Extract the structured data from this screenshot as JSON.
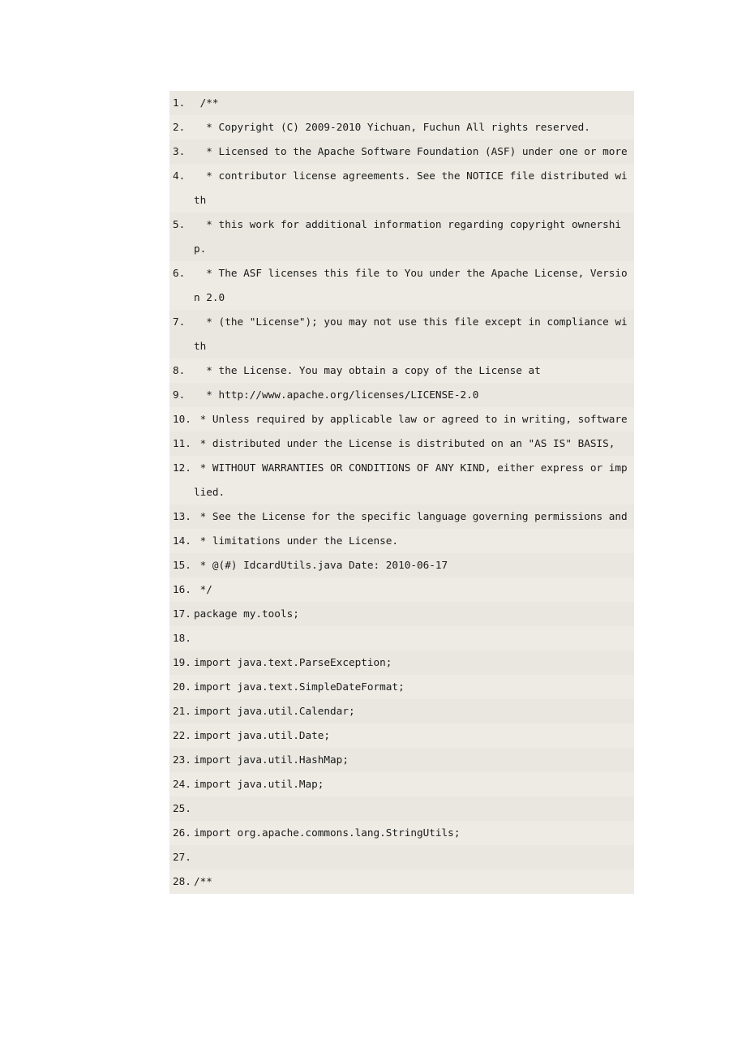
{
  "document": {
    "language": "java",
    "background_color": "#e9e7e0",
    "page_background": "#ffffff",
    "text_color": "#1a1a1a",
    "first_line_number": 1,
    "last_line_number": 28
  },
  "code": {
    "lines": [
      {
        "number": "1.",
        "text": " /**"
      },
      {
        "number": "2.",
        "text": "  * Copyright (C) 2009-2010 Yichuan, Fuchun All rights reserved."
      },
      {
        "number": "3.",
        "text": "  * Licensed to the Apache Software Foundation (ASF) under one or more"
      },
      {
        "number": "4.",
        "text": "  * contributor license agreements. See the NOTICE file distributed with"
      },
      {
        "number": "5.",
        "text": "  * this work for additional information regarding copyright ownership. "
      },
      {
        "number": "6.",
        "text": "  * The ASF licenses this file to You under the Apache License, Version 2.0"
      },
      {
        "number": "7.",
        "text": "  * (the \"License\"); you may not use this file except in compliance with"
      },
      {
        "number": "8.",
        "text": "  * the License. You may obtain a copy of the License at"
      },
      {
        "number": "9.",
        "text": "  * http://www.apache.org/licenses/LICENSE-2.0"
      },
      {
        "number": "10.",
        "text": " * Unless required by applicable law or agreed to in writing, software "
      },
      {
        "number": "11.",
        "text": " * distributed under the License is distributed on an \"AS IS\" BASIS,"
      },
      {
        "number": "12.",
        "text": " * WITHOUT WARRANTIES OR CONDITIONS OF ANY KIND, either express or implied."
      },
      {
        "number": "13.",
        "text": " * See the License for the specific language governing permissions and "
      },
      {
        "number": "14.",
        "text": " * limitations under the License."
      },
      {
        "number": "15.",
        "text": " * @(#) IdcardUtils.java Date: 2010-06-17"
      },
      {
        "number": "16.",
        "text": " */"
      },
      {
        "number": "17.",
        "text": "package my.tools;"
      },
      {
        "number": "18.",
        "text": ""
      },
      {
        "number": "19.",
        "text": "import java.text.ParseException;"
      },
      {
        "number": "20.",
        "text": "import java.text.SimpleDateFormat;"
      },
      {
        "number": "21.",
        "text": "import java.util.Calendar;"
      },
      {
        "number": "22.",
        "text": "import java.util.Date;"
      },
      {
        "number": "23.",
        "text": "import java.util.HashMap;"
      },
      {
        "number": "24.",
        "text": "import java.util.Map;"
      },
      {
        "number": "25.",
        "text": ""
      },
      {
        "number": "26.",
        "text": "import org.apache.commons.lang.StringUtils;"
      },
      {
        "number": "27.",
        "text": ""
      },
      {
        "number": "28.",
        "text": "/**"
      }
    ]
  }
}
